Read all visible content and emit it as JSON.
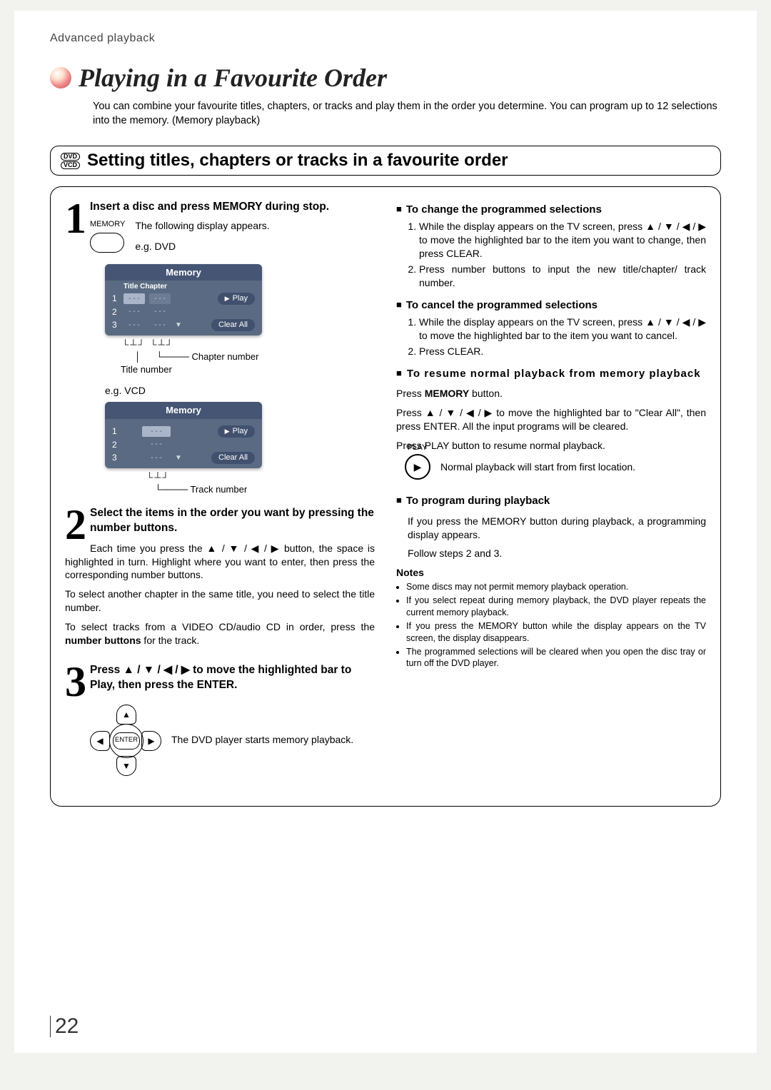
{
  "breadcrumb": "Advanced playback",
  "title": "Playing in a Favourite Order",
  "intro": "You can combine your favourite titles, chapters, or tracks and play them in the order you determine. You can program up to 12 selections into the memory. (Memory playback)",
  "section_heading": "Setting titles, chapters or tracks in a favourite order",
  "badges": {
    "dvd": "DVD",
    "vcd": "VCD"
  },
  "step1": {
    "heading": "Insert a disc and press MEMORY during stop.",
    "mem_label": "MEMORY",
    "following": "The following display appears.",
    "eg_dvd": "e.g.   DVD",
    "eg_vcd": "e.g.   VCD",
    "osd_header": "Memory",
    "osd_dvd_sub": "Title   Chapter",
    "osd_play": "Play",
    "osd_clear": "Clear All",
    "cell_dash": "- - -",
    "rows": [
      "1",
      "2",
      "3"
    ],
    "note_chapter": "Chapter number",
    "note_title": "Title number",
    "note_track": "Track number"
  },
  "step2": {
    "heading": "Select the items in the order you want by pressing the number buttons.",
    "p1a": "Each time you press the ",
    "p1b": " button, the space is highlighted in turn. Highlight where you want to enter, then press the corresponding number buttons.",
    "p2": "To select another chapter in the same title, you need to select the title number.",
    "p3a": "To select tracks from a VIDEO CD/audio CD in order, press the ",
    "p3b": "number buttons",
    "p3c": " for the track."
  },
  "step3": {
    "heading_a": "Press ",
    "heading_b": " to move the highlighted bar to Play, then press the ENTER.",
    "enter_label": "ENTER",
    "result": "The DVD player starts memory playback."
  },
  "arrow_combo": "▲ / ▼ / ◀ / ▶",
  "arrow_combo_bold": "▲ / ▼ / ◀ / ▶",
  "right": {
    "h1": "To change the programmed selections",
    "l1_1a": "While the display appears on the TV screen, press ",
    "l1_1b": " to move the highlighted bar to the item you want to change, then press CLEAR.",
    "l1_2": "Press number buttons to input the new title/chapter/ track number.",
    "h2": "To cancel the programmed selections",
    "l2_1a": "While the display appears on the TV screen, press ",
    "l2_1b": " to move the highlighted bar to the item you want to cancel.",
    "l2_2": "Press CLEAR.",
    "h3": "To resume normal playback from memory playback",
    "p3a": "Press ",
    "p3a_bold": "MEMORY",
    "p3a_end": " button.",
    "p3b_a": "Press ",
    "p3b_b": " to move the highlighted bar to \"Clear All\", then press ENTER. All the input programs will be cleared.",
    "p3c": "Press PLAY button to resume normal playback.",
    "play_label": "PLAY",
    "p3d": "Normal playback will start from first location.",
    "h4": "To program during playback",
    "p4a": "If you press the MEMORY button during playback, a programming display appears.",
    "p4b": "Follow steps 2 and 3.",
    "notes_head": "Notes",
    "notes": [
      "Some discs may not permit memory playback operation.",
      "If you select repeat during memory playback, the DVD player repeats the current memory playback.",
      "If you press the MEMORY button while the display appears on the TV screen, the display disappears.",
      "The programmed selections will be cleared when you open the disc tray or turn off the DVD player."
    ]
  },
  "page_number": "22"
}
